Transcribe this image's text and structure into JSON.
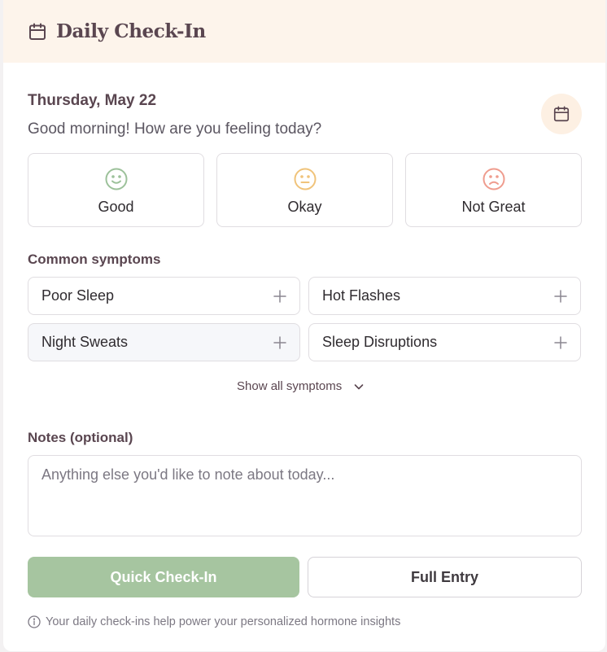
{
  "header": {
    "title": "Daily Check-In",
    "icon": "calendar-icon"
  },
  "date": "Thursday, May 22",
  "greeting": "Good morning! How are you feeling today?",
  "moods": [
    {
      "label": "Good",
      "icon": "smile-icon",
      "color": "#9cc19a"
    },
    {
      "label": "Okay",
      "icon": "neutral-face-icon",
      "color": "#f0c37a"
    },
    {
      "label": "Not Great",
      "icon": "frown-icon",
      "color": "#ef9c8e"
    }
  ],
  "symptoms": {
    "heading": "Common symptoms",
    "items": [
      {
        "label": "Poor Sleep"
      },
      {
        "label": "Hot Flashes"
      },
      {
        "label": "Night Sweats"
      },
      {
        "label": "Sleep Disruptions"
      }
    ],
    "show_all": "Show all symptoms"
  },
  "notes": {
    "heading": "Notes (optional)",
    "placeholder": "Anything else you'd like to note about today...",
    "value": ""
  },
  "actions": {
    "primary": "Quick Check-In",
    "secondary": "Full Entry"
  },
  "footer": "Your daily check-ins help power your personalized hormone insights",
  "colors": {
    "header_bg": "#fdf4eb",
    "primary_button": "#a6c5a0",
    "heading_text": "#5a4650"
  }
}
